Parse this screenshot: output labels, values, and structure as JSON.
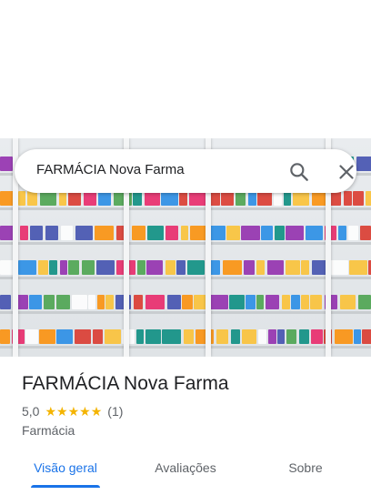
{
  "search": {
    "query": "FARMÁCIA Nova Farma"
  },
  "place": {
    "title": "FARMÁCIA Nova Farma",
    "rating": "5,0",
    "stars": [
      "★",
      "★",
      "★",
      "★",
      "★"
    ],
    "review_count": "(1)",
    "category": "Farmácia"
  },
  "tabs": [
    {
      "label": "Visão geral",
      "active": true
    },
    {
      "label": "Avaliações",
      "active": false
    },
    {
      "label": "Sobre",
      "active": false
    }
  ],
  "icons": {
    "search": "search-icon",
    "close": "close-icon"
  },
  "colors": {
    "accent": "#1a73e8",
    "star": "#f4b400"
  }
}
